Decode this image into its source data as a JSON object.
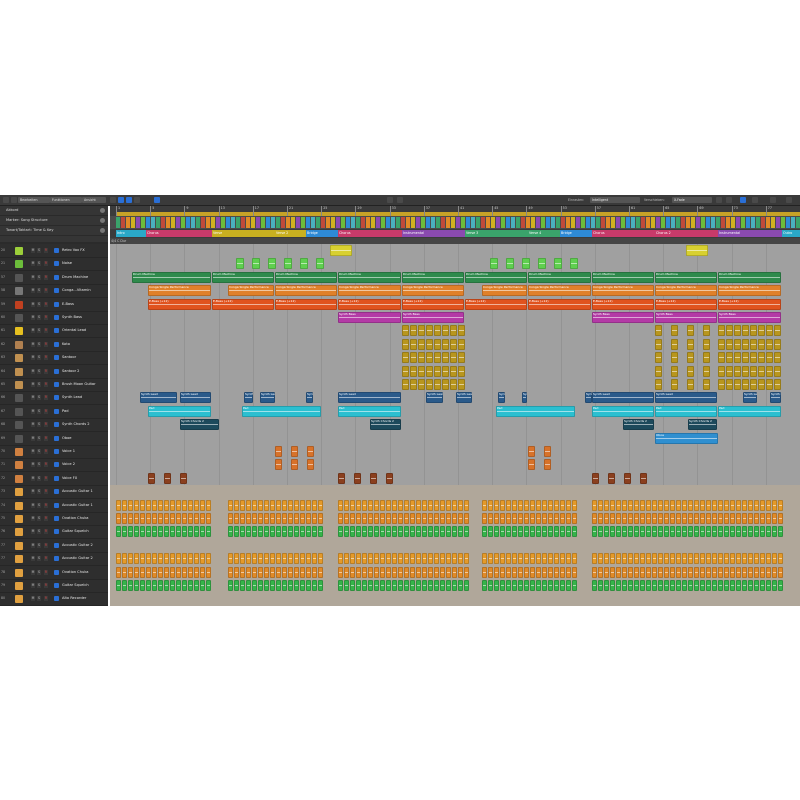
{
  "toolbar": {
    "menu_edit": "Bearbeiten",
    "menu_functions": "Funktionen",
    "menu_view": "Ansicht",
    "snap_label": "Einrasten:",
    "snap_value": "Intelligent",
    "drag_label": "Verschieben:",
    "drag_value": "X-Fade"
  },
  "global_tracks": [
    "Akkord",
    "Marker: Song Structure",
    "Tonart/Taktart: Time & Key"
  ],
  "signature": "4/4 C Dur",
  "ruler_ticks": [
    "1",
    "5",
    "9",
    "13",
    "17",
    "21",
    "25",
    "29",
    "33",
    "37",
    "41",
    "45",
    "49",
    "53",
    "57",
    "61",
    "65",
    "69",
    "73",
    "77"
  ],
  "markers": [
    "Intro",
    "Chorus",
    "Verse",
    "Verse 2",
    "Bridge",
    "Chorus",
    "Instrumental",
    "Verse 3",
    "Verse 4",
    "Bridge",
    "Chorus",
    "Chorus 2",
    "Instrumental",
    "Outro"
  ],
  "tracks": [
    {
      "num": "20",
      "name": "Retro Vox FX",
      "color": "#9ccf3a",
      "icon": "#9ccf3a"
    },
    {
      "num": "21",
      "name": "Noise",
      "color": "#5fcf4f",
      "icon": "#6cbd3b"
    },
    {
      "num": "57",
      "name": "Drum Machine",
      "color": "#2e8a4c",
      "icon": "#555"
    },
    {
      "num": "58",
      "name": "Conga...Vitamin",
      "color": "#e0802a",
      "icon": "#777"
    },
    {
      "num": "59",
      "name": "E-Bass",
      "color": "#e0531e",
      "icon": "#c04020"
    },
    {
      "num": "60",
      "name": "Synth Bass",
      "color": "#b43aa6",
      "icon": "#555"
    },
    {
      "num": "61",
      "name": "Oriental Lead",
      "color": "#b8961e",
      "icon": "#e6c020"
    },
    {
      "num": "62",
      "name": "Koto",
      "color": "#b8961e",
      "icon": "#b08050"
    },
    {
      "num": "63",
      "name": "Santoor",
      "color": "#b8961e",
      "icon": "#c09050"
    },
    {
      "num": "64",
      "name": "Santoor 2",
      "color": "#b8961e",
      "icon": "#c09050"
    },
    {
      "num": "65",
      "name": "Brush Moon Guitar",
      "color": "#b8961e",
      "icon": "#c09050"
    },
    {
      "num": "66",
      "name": "Synth Lead",
      "color": "#2a5a8a",
      "icon": "#555"
    },
    {
      "num": "67",
      "name": "Pad",
      "color": "#2bbfd0",
      "icon": "#555"
    },
    {
      "num": "68",
      "name": "Synth Chords 2",
      "color": "#1d4a5c",
      "icon": "#555"
    },
    {
      "num": "69",
      "name": "Oboe",
      "color": "#2f8fd0",
      "icon": "#555"
    },
    {
      "num": "70",
      "name": "Voice 1",
      "color": "#d7722a",
      "icon": "#d08040"
    },
    {
      "num": "71",
      "name": "Voice 2",
      "color": "#d7722a",
      "icon": "#d08040"
    },
    {
      "num": "72",
      "name": "Voice FX",
      "color": "#8a3f1e",
      "icon": "#d08040"
    },
    {
      "num": "73",
      "name": "Acoustic Guitar 1",
      "color": "#e49a2a",
      "icon": "#e0a040"
    },
    {
      "num": "74",
      "name": "Acoustic Guitar 1",
      "color": "#e49a2a",
      "icon": "#e0a040"
    },
    {
      "num": "75",
      "name": "Ovation Chuka",
      "color": "#e08a28",
      "icon": "#e0a040"
    },
    {
      "num": "76",
      "name": "Guitar Squelch",
      "color": "#36b34a",
      "icon": "#e0a040"
    },
    {
      "num": "77",
      "name": "Acoustic Guitar 2",
      "color": "#e49a2a",
      "icon": "#e0a040"
    },
    {
      "num": "77",
      "name": "Acoustic Guitar 2",
      "color": "#e49a2a",
      "icon": "#e0a040"
    },
    {
      "num": "78",
      "name": "Ovation Chuka",
      "color": "#e08a28",
      "icon": "#e0a040"
    },
    {
      "num": "79",
      "name": "Guitar Squelch",
      "color": "#36b34a",
      "icon": "#e0a040"
    },
    {
      "num": "80",
      "name": "Alto Recorder",
      "color": "#b8961e",
      "icon": "#e0a040"
    }
  ],
  "region_names": {
    "drum": "Drum Machine",
    "conga": "Conga Single Performance",
    "ebass": "E-Bass (+12)",
    "synthbass": "Synth Bass",
    "synthlead": "Synth Lead",
    "pad": "Pad",
    "chords": "Synth Chords 2",
    "oboe": "Oboe",
    "guitarfolder": "Acoustic Guitar 1",
    "guitarfolder2": "Acoustic Guitar 2"
  }
}
